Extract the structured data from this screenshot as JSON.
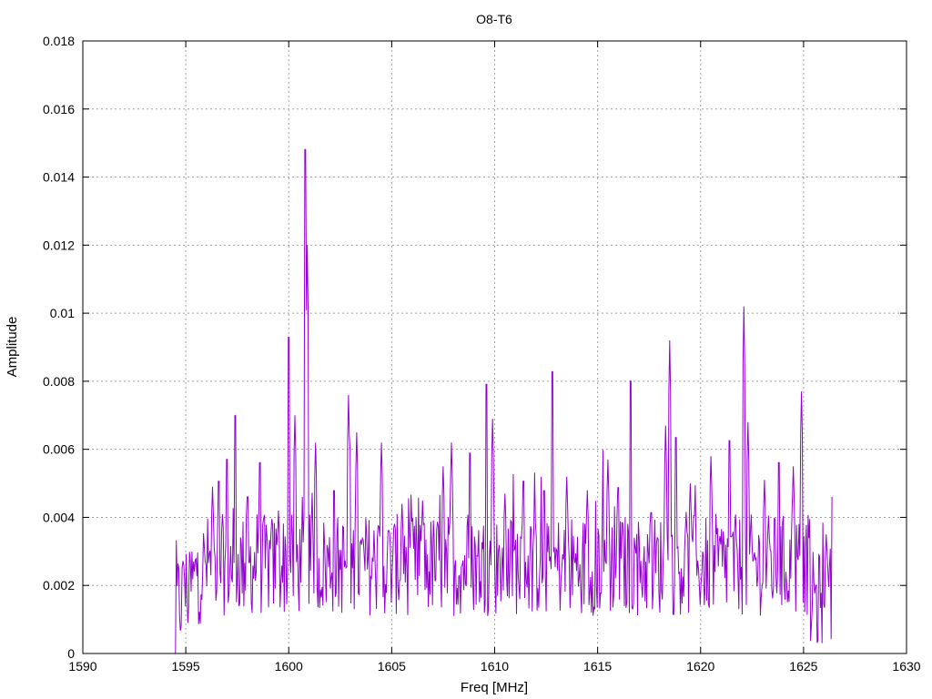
{
  "chart_data": {
    "type": "line",
    "title": "O8-T6",
    "xlabel": "Freq [MHz]",
    "ylabel": "Amplitude",
    "xlim": [
      1590,
      1630
    ],
    "ylim": [
      0,
      0.018
    ],
    "x_ticks": [
      "1590",
      "1595",
      "1600",
      "1605",
      "1610",
      "1615",
      "1620",
      "1625",
      "1630"
    ],
    "y_ticks": [
      "0",
      "0.002",
      "0.004",
      "0.006",
      "0.008",
      "0.01",
      "0.012",
      "0.014",
      "0.016",
      "0.018"
    ],
    "grid": true,
    "series_color": "#9400d3",
    "series": [
      {
        "x_start": 1594.5,
        "x_step": 0.04,
        "noise_amplitude": 0.0015,
        "peaks": [
          [
            1594.9,
            0.0026
          ],
          [
            1595.5,
            0.0027
          ],
          [
            1596.3,
            0.0049
          ],
          [
            1596.6,
            0.0055
          ],
          [
            1597.0,
            0.0062
          ],
          [
            1597.4,
            0.0076
          ],
          [
            1598.0,
            0.005
          ],
          [
            1598.6,
            0.0061
          ],
          [
            1599.5,
            0.0042
          ],
          [
            1600.0,
            0.0101
          ],
          [
            1600.3,
            0.007
          ],
          [
            1600.8,
            0.0161
          ],
          [
            1600.9,
            0.012
          ],
          [
            1601.3,
            0.0062
          ],
          [
            1602.2,
            0.0052
          ],
          [
            1602.9,
            0.0076
          ],
          [
            1603.3,
            0.0065
          ],
          [
            1604.5,
            0.0062
          ],
          [
            1605.5,
            0.0044
          ],
          [
            1606.5,
            0.0045
          ],
          [
            1607.5,
            0.0055
          ],
          [
            1607.9,
            0.0062
          ],
          [
            1608.8,
            0.0064
          ],
          [
            1609.6,
            0.0086
          ],
          [
            1609.9,
            0.0069
          ],
          [
            1610.5,
            0.0047
          ],
          [
            1611.4,
            0.0055
          ],
          [
            1612.4,
            0.0052
          ],
          [
            1612.8,
            0.009
          ],
          [
            1613.5,
            0.0052
          ],
          [
            1614.5,
            0.0048
          ],
          [
            1615.5,
            0.0057
          ],
          [
            1616.0,
            0.0053
          ],
          [
            1616.6,
            0.0087
          ],
          [
            1617.6,
            0.0045
          ],
          [
            1618.3,
            0.0067
          ],
          [
            1618.5,
            0.0092
          ],
          [
            1618.8,
            0.0069
          ],
          [
            1619.5,
            0.005
          ],
          [
            1620.5,
            0.0058
          ],
          [
            1621.4,
            0.0068
          ],
          [
            1622.1,
            0.0102
          ],
          [
            1622.3,
            0.0068
          ],
          [
            1623.1,
            0.0051
          ],
          [
            1623.8,
            0.0061
          ],
          [
            1624.5,
            0.0055
          ],
          [
            1624.9,
            0.0077
          ],
          [
            1625.5,
            0.0021
          ],
          [
            1626.1,
            0.0035
          ],
          [
            1626.4,
            0.005
          ]
        ]
      }
    ]
  }
}
